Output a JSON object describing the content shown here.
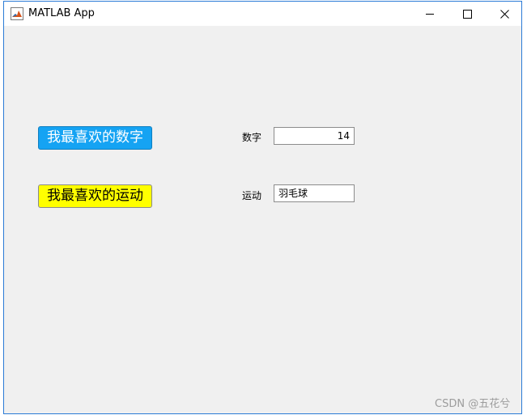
{
  "window": {
    "title": "MATLAB App",
    "controls": {
      "minimize": "minimize",
      "maximize": "maximize",
      "close": "close"
    }
  },
  "buttons": {
    "favorite_number": {
      "label": "我最喜欢的数字",
      "background": "#15a3f3",
      "text_color": "#ffffff"
    },
    "favorite_sport": {
      "label": "我最喜欢的运动",
      "background": "#ffff00",
      "text_color": "#000000"
    }
  },
  "fields": {
    "number": {
      "label": "数字",
      "value": "14"
    },
    "sport": {
      "label": "运动",
      "value": "羽毛球"
    }
  },
  "watermark": "CSDN @五花兮",
  "icons": {
    "app": "matlab-icon",
    "minimize": "minimize-icon",
    "maximize": "maximize-icon",
    "close": "close-icon"
  },
  "colors": {
    "window_border": "#2b7bd6",
    "background": "#f0f0f0"
  }
}
